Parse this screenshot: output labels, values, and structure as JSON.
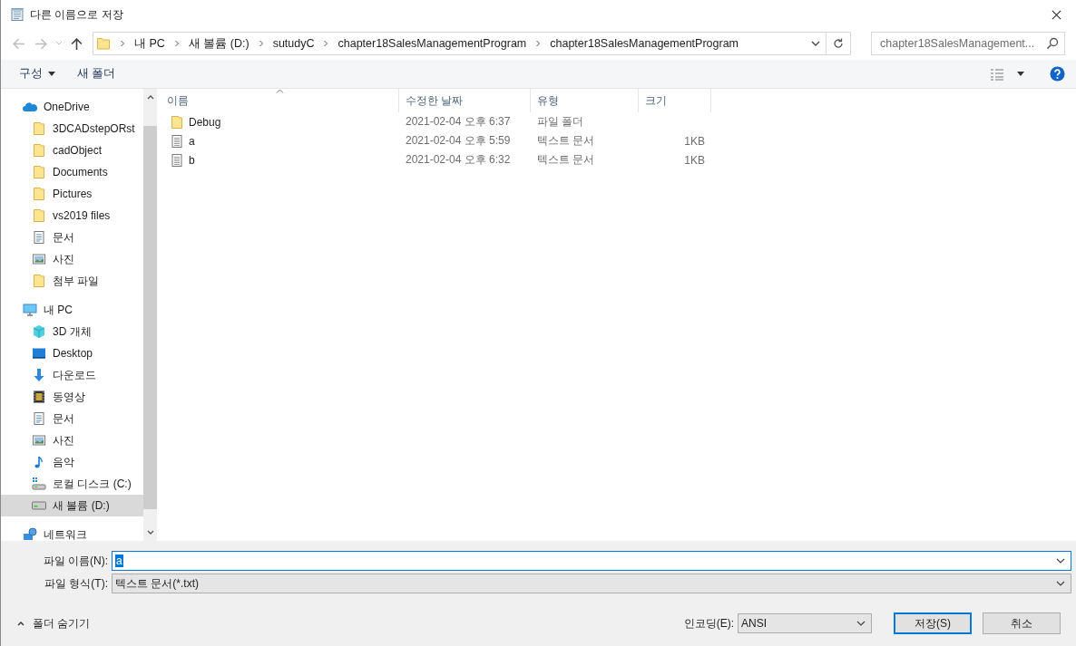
{
  "window": {
    "title": "다른 이름으로 저장"
  },
  "address_bar": {
    "path": [
      "내 PC",
      "새 볼륨 (D:)",
      "sutudyC",
      "chapter18SalesManagementProgram",
      "chapter18SalesManagementProgram"
    ]
  },
  "search": {
    "placeholder": "chapter18SalesManagement..."
  },
  "toolbar": {
    "organize": "구성",
    "new_folder": "새 폴더"
  },
  "sidebar": {
    "items": [
      {
        "label": "OneDrive",
        "kind": "cloud",
        "selected": false,
        "children": [
          {
            "label": "3DCADstepORst",
            "kind": "folder",
            "selected": false
          },
          {
            "label": "cadObject",
            "kind": "folder",
            "selected": false
          },
          {
            "label": "Documents",
            "kind": "folder",
            "selected": false
          },
          {
            "label": "Pictures",
            "kind": "folder",
            "selected": false
          },
          {
            "label": "vs2019 files",
            "kind": "folder",
            "selected": false
          },
          {
            "label": "문서",
            "kind": "document",
            "selected": false
          },
          {
            "label": "사진",
            "kind": "picture",
            "selected": false
          },
          {
            "label": "첨부 파일",
            "kind": "folder",
            "selected": false
          }
        ]
      },
      {
        "label": "내 PC",
        "kind": "pc",
        "selected": false,
        "children": [
          {
            "label": "3D 개체",
            "kind": "cube",
            "selected": false
          },
          {
            "label": "Desktop",
            "kind": "desktop",
            "selected": false
          },
          {
            "label": "다운로드",
            "kind": "download",
            "selected": false
          },
          {
            "label": "동영상",
            "kind": "video",
            "selected": false
          },
          {
            "label": "문서",
            "kind": "document",
            "selected": false
          },
          {
            "label": "사진",
            "kind": "picture",
            "selected": false
          },
          {
            "label": "음악",
            "kind": "music",
            "selected": false
          },
          {
            "label": "로컬 디스크 (C:)",
            "kind": "system-drive",
            "selected": false
          },
          {
            "label": "새 볼륨 (D:)",
            "kind": "drive",
            "selected": true
          }
        ]
      },
      {
        "label": "네트워크",
        "kind": "network",
        "selected": false
      }
    ]
  },
  "file_list": {
    "columns": [
      {
        "label": "이름",
        "sorted": true
      },
      {
        "label": "수정한 날짜",
        "sorted": false
      },
      {
        "label": "유형",
        "sorted": false
      },
      {
        "label": "크기",
        "sorted": false
      }
    ],
    "rows": [
      {
        "name": "Debug",
        "kind": "folder",
        "modified": "2021-02-04 오후 6:37",
        "type": "파일 폴더"
      },
      {
        "name": "a",
        "kind": "text",
        "modified": "2021-02-04 오후 5:59",
        "type": "텍스트 문서",
        "size": "1KB"
      },
      {
        "name": "b",
        "kind": "text",
        "modified": "2021-02-04 오후 6:32",
        "type": "텍스트 문서",
        "size": "1KB"
      }
    ]
  },
  "form": {
    "file_name": {
      "label": "파일 이름(N):",
      "value": "a",
      "text_selected": true
    },
    "file_type": {
      "label": "파일 형식(T):",
      "value": "텍스트 문서(*.txt)"
    },
    "encoding": {
      "label": "인코딩(E):",
      "value": "ANSI"
    }
  },
  "hide_folders": "폴더 숨기기",
  "buttons": [
    {
      "label": "저장(S)",
      "default": true
    },
    {
      "label": "취소",
      "default": false
    }
  ]
}
